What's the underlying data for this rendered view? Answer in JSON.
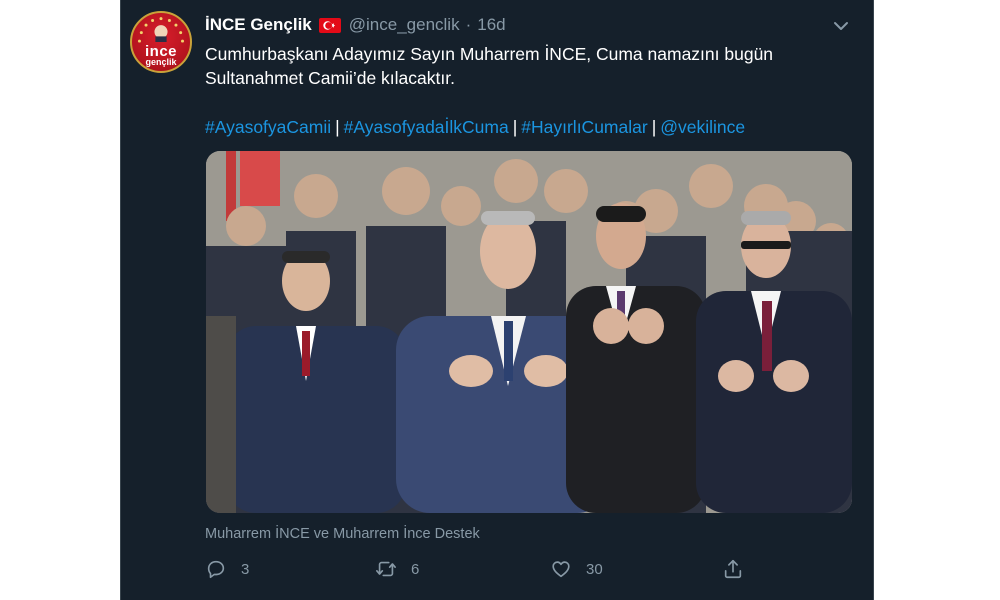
{
  "tweet": {
    "display_name": "İNCE Gençlik",
    "handle": "@ince_genclik",
    "separator": "·",
    "age": "16d",
    "text": "Cumhurbaşkanı Adayımız Sayın Muharrem İNCE, Cuma namazını bugün Sultanahmet Camii’de kılacaktır.",
    "hashtags": [
      "#AyasofyaCamii",
      "#AyasofyadaİlkCuma",
      "#HayırlıCumalar",
      "@vekilince"
    ],
    "hashtag_separator": "|",
    "caption": "Muharrem İNCE ve Muharrem İnce Destek",
    "avatar_text_top": "ince",
    "avatar_text_bottom": "gençlik"
  },
  "actions": {
    "reply_count": "3",
    "retweet_count": "6",
    "like_count": "30"
  },
  "icons": [
    "menu-caret-icon",
    "reply-icon",
    "retweet-icon",
    "like-icon",
    "share-icon",
    "turkey-flag-icon"
  ],
  "colors": {
    "background": "#15202b",
    "text": "#ffffff",
    "muted": "#8899a6",
    "link": "#1b95e0",
    "flag_red": "#e30a17"
  }
}
